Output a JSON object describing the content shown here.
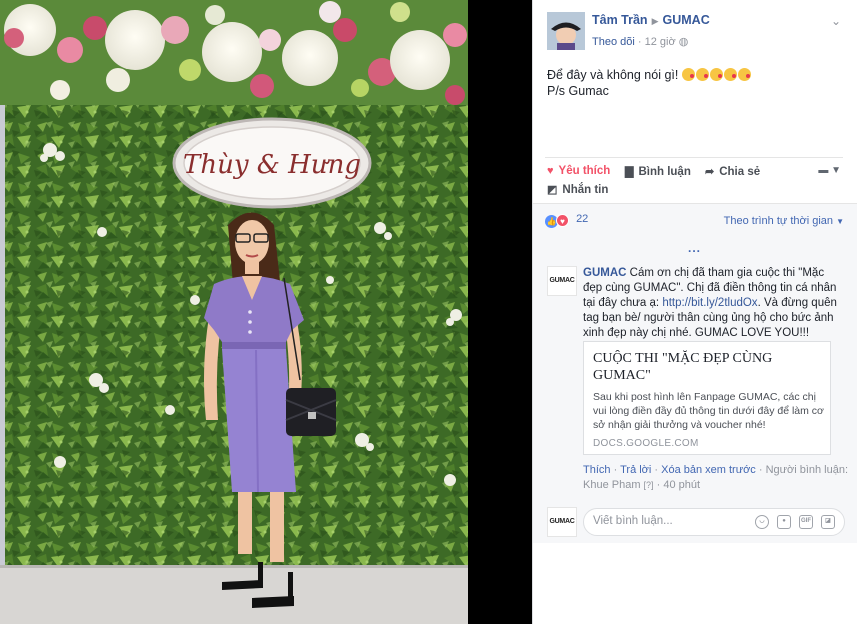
{
  "post": {
    "author": "Tâm Trần",
    "page": "GUMAC",
    "follow": "Theo dõi",
    "time": "12 giờ",
    "message_line1": "Để đây và không nói gì!",
    "message_line2": "P/s Gumac"
  },
  "photo": {
    "sign_text": "Thùy & Hưng"
  },
  "actions": {
    "like": "Yêu thích",
    "comment": "Bình luận",
    "share": "Chia sẻ",
    "message": "Nhắn tin"
  },
  "reactions": {
    "count": "22",
    "sort_label": "Theo trình tự thời gian",
    "more": "..."
  },
  "comment": {
    "author": "GUMAC",
    "avatar_text": "GUMAC",
    "text_part1": " Cám ơn chị đã tham gia cuộc thi \"Mặc đẹp cùng GUMAC\". Chị đã điền thông tin cá nhân tại đây chưa ạ: ",
    "link": "http://bit.ly/2tludOx",
    "text_part2": ". Và đừng quên tag bạn bè/ người thân cùng ủng hộ cho bức ảnh xinh đẹp này chị nhé. GUMAC LOVE YOU!!!",
    "card_title": "CUỘC THI \"MẶC ĐẸP CÙNG GUMAC\"",
    "card_desc": "Sau khi post hình lên Fanpage GUMAC, các chị vui lòng điền đầy đủ thông tin dưới đây để làm cơ sở nhận giải thưởng và voucher nhé!",
    "card_domain": "DOCS.GOOGLE.COM",
    "like": "Thích",
    "reply": "Trả lời",
    "preview": "Xóa bản xem trước",
    "sep": " · ",
    "commenter_prefix": "Người bình luận: Khue Pham",
    "q": "[?]",
    "time": "40 phút"
  },
  "composer": {
    "placeholder": "Viết bình luận...",
    "avatar_text": "GUMAC"
  },
  "colors": {
    "link_blue": "#365899",
    "love_red": "#f25268",
    "like_blue": "#5890ff"
  }
}
